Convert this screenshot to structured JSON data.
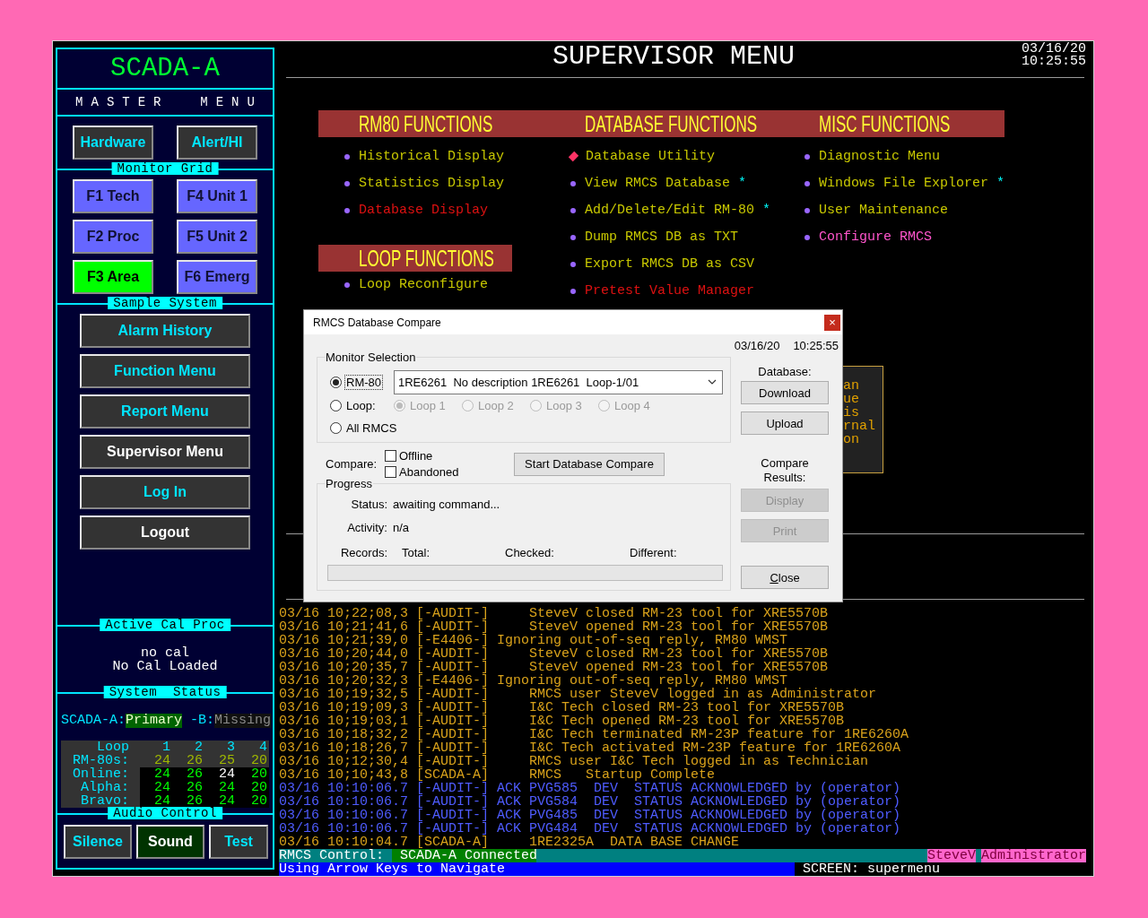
{
  "sidebar": {
    "title": "SCADA-A",
    "subtitle": "MASTER  MENU",
    "top_buttons": [
      {
        "label": "Hardware"
      },
      {
        "label": "Alert/HI"
      }
    ],
    "monitor_grid": {
      "label": "Monitor Grid",
      "buttons": [
        {
          "label": "F1 Tech",
          "selected": false
        },
        {
          "label": "F4 Unit 1",
          "selected": false
        },
        {
          "label": "F2 Proc",
          "selected": false
        },
        {
          "label": "F5 Unit 2",
          "selected": false
        },
        {
          "label": "F3 Area",
          "selected": true
        },
        {
          "label": "F6 Emerg",
          "selected": false
        }
      ]
    },
    "sample_system": {
      "label": "Sample System",
      "buttons": [
        {
          "label": "Alarm History",
          "kind": "nav"
        },
        {
          "label": "Function Menu",
          "kind": "nav"
        },
        {
          "label": "Report Menu",
          "kind": "nav"
        },
        {
          "label": "Supervisor Menu",
          "kind": "action"
        },
        {
          "label": "Log In",
          "kind": "nav"
        },
        {
          "label": "Logout",
          "kind": "action"
        }
      ]
    },
    "active_cal": {
      "label": "Active Cal Proc",
      "lines": [
        "no cal",
        "No Cal Loaded"
      ]
    },
    "system_status": {
      "label": "System  Status",
      "primary_label": "SCADA-A:",
      "primary_state": {
        "text": "Primary",
        "kind": "ok"
      },
      "backup_label": "-B:",
      "backup_state": {
        "text": "Missing",
        "kind": "missing"
      },
      "loop_table": [
        {
          "kind": "header",
          "label": "Loop",
          "values": [
            {
              "text": "1",
              "kind": "heading"
            },
            {
              "text": "2",
              "kind": "heading"
            },
            {
              "text": "3",
              "kind": "heading"
            },
            {
              "text": "4",
              "kind": "heading"
            }
          ]
        },
        {
          "kind": "count",
          "label": "RM-80s:",
          "values": [
            {
              "text": "24",
              "kind": "count"
            },
            {
              "text": "26",
              "kind": "count"
            },
            {
              "text": "25",
              "kind": "count"
            },
            {
              "text": "20",
              "kind": "count"
            }
          ]
        },
        {
          "kind": "status",
          "label": "Online:",
          "values": [
            {
              "text": "24",
              "kind": "ok"
            },
            {
              "text": "26",
              "kind": "ok"
            },
            {
              "text": "24",
              "kind": "changed"
            },
            {
              "text": "20",
              "kind": "ok"
            }
          ]
        },
        {
          "kind": "status",
          "label": "Alpha:",
          "values": [
            {
              "text": "24",
              "kind": "ok"
            },
            {
              "text": "26",
              "kind": "ok"
            },
            {
              "text": "24",
              "kind": "ok"
            },
            {
              "text": "20",
              "kind": "ok"
            }
          ]
        },
        {
          "kind": "status",
          "label": "Bravo:",
          "values": [
            {
              "text": "24",
              "kind": "ok"
            },
            {
              "text": "26",
              "kind": "ok"
            },
            {
              "text": "24",
              "kind": "ok"
            },
            {
              "text": "20",
              "kind": "ok"
            }
          ]
        }
      ]
    },
    "audio": {
      "label": "Audio Control",
      "buttons": [
        {
          "label": "Silence",
          "selected": false
        },
        {
          "label": "Sound",
          "selected": true
        },
        {
          "label": "Test",
          "selected": false
        }
      ]
    }
  },
  "header": {
    "title": "SUPERVISOR MENU",
    "date": "03/16/20",
    "time": "10:25:55"
  },
  "menu": {
    "columns": [
      {
        "heading": "RM80 FUNCTIONS",
        "items": [
          {
            "label": "Historical Display",
            "kind": "normal",
            "selected": false
          },
          {
            "label": "Statistics Display",
            "kind": "normal",
            "selected": false
          },
          {
            "label": "Database Display",
            "kind": "unavailable",
            "selected": false
          }
        ],
        "subsection": {
          "heading": "LOOP FUNCTIONS",
          "items": [
            {
              "label": "Loop Reconfigure",
              "kind": "normal",
              "selected": false
            }
          ]
        }
      },
      {
        "heading": "DATABASE FUNCTIONS",
        "items": [
          {
            "label": "Database Utility",
            "kind": "normal",
            "selected": true
          },
          {
            "label": "View RMCS Database",
            "kind": "normal",
            "selected": false,
            "note": "*"
          },
          {
            "label": "Add/Delete/Edit RM-80",
            "kind": "normal",
            "selected": false,
            "note": "*"
          },
          {
            "label": "Dump RMCS DB as TXT",
            "kind": "normal",
            "selected": false
          },
          {
            "label": "Export RMCS DB as CSV",
            "kind": "normal",
            "selected": false
          },
          {
            "label": "Pretest Value Manager",
            "kind": "unavailable",
            "selected": false
          }
        ]
      },
      {
        "heading": "MISC FUNCTIONS",
        "items": [
          {
            "label": "Diagnostic Menu",
            "kind": "normal",
            "selected": false
          },
          {
            "label": "Windows File Explorer",
            "kind": "normal",
            "selected": false,
            "note": "*"
          },
          {
            "label": "User Maintenance",
            "kind": "normal",
            "selected": false
          },
          {
            "label": "Configure RMCS",
            "kind": "highlight",
            "selected": false
          }
        ]
      }
    ]
  },
  "hidden_panel": {
    "lines": [
      "an",
      "ue",
      "is",
      "rnal",
      "on"
    ]
  },
  "dialog": {
    "title": "RMCS Database Compare",
    "close": "×",
    "date": "03/16/20",
    "time": "10:25:55",
    "monitor_selection": {
      "label": "Monitor Selection",
      "options": [
        {
          "label": "RM-80",
          "selected": true,
          "focused": true
        },
        {
          "label": "Loop:",
          "selected": false,
          "focused": false
        },
        {
          "label": "All RMCS",
          "selected": false,
          "focused": false
        }
      ],
      "device": "1RE6261  No description 1RE6261  Loop-1/01",
      "loops": [
        {
          "label": "Loop 1",
          "selected": true,
          "disabled": true
        },
        {
          "label": "Loop 2",
          "selected": false,
          "disabled": true
        },
        {
          "label": "Loop 3",
          "selected": false,
          "disabled": true
        },
        {
          "label": "Loop 4",
          "selected": false,
          "disabled": true
        }
      ]
    },
    "compare": {
      "label": "Compare:",
      "options": [
        {
          "label": "Offline",
          "checked": false
        },
        {
          "label": "Abandoned",
          "checked": false
        }
      ],
      "start_button": "Start Database Compare"
    },
    "progress": {
      "label": "Progress",
      "status_label": "Status:",
      "status": "awaiting command...",
      "activity_label": "Activity:",
      "activity": "n/a",
      "records_label": "Records:",
      "total_label": "Total:",
      "checked_label": "Checked:",
      "different_label": "Different:",
      "level": 0
    },
    "database_label": "Database:",
    "database_buttons": [
      {
        "label": "Download",
        "disabled": false
      },
      {
        "label": "Upload",
        "disabled": false
      }
    ],
    "results_label": "Compare Results:",
    "result_buttons": [
      {
        "label": "Display",
        "disabled": true
      },
      {
        "label": "Print",
        "disabled": true
      }
    ],
    "close_button": "Close"
  },
  "log": [
    {
      "kind": "event",
      "text": "03/16 10;22;08,3 [-AUDIT-]     SteveV closed RM-23 tool for XRE5570B"
    },
    {
      "kind": "event",
      "text": "03/16 10;21;41,6 [-AUDIT-]     SteveV opened RM-23 tool for XRE5570B"
    },
    {
      "kind": "event",
      "text": "03/16 10;21;39,0 [-E4406-] Ignoring out-of-seq reply, RM80 WMST"
    },
    {
      "kind": "event",
      "text": "03/16 10;20;44,0 [-AUDIT-]     SteveV closed RM-23 tool for XRE5570B"
    },
    {
      "kind": "event",
      "text": "03/16 10;20;35,7 [-AUDIT-]     SteveV opened RM-23 tool for XRE5570B"
    },
    {
      "kind": "event",
      "text": "03/16 10;20;32,3 [-E4406-] Ignoring out-of-seq reply, RM80 WMST"
    },
    {
      "kind": "event",
      "text": "03/16 10;19;32,5 [-AUDIT-]     RMCS user SteveV logged in as Administrator"
    },
    {
      "kind": "event",
      "text": "03/16 10;19;09,3 [-AUDIT-]     I&C Tech closed RM-23 tool for XRE5570B"
    },
    {
      "kind": "event",
      "text": "03/16 10;19;03,1 [-AUDIT-]     I&C Tech opened RM-23 tool for XRE5570B"
    },
    {
      "kind": "event",
      "text": "03/16 10;18;32,2 [-AUDIT-]     I&C Tech terminated RM-23P feature for 1RE6260A"
    },
    {
      "kind": "event",
      "text": "03/16 10;18;26,7 [-AUDIT-]     I&C Tech activated RM-23P feature for 1RE6260A"
    },
    {
      "kind": "event",
      "text": "03/16 10;12;30,4 [-AUDIT-]     RMCS user I&C Tech logged in as Technician"
    },
    {
      "kind": "event",
      "text": "03/16 10;10;43,8 [SCADA-A]     RMCS   Startup Complete"
    },
    {
      "kind": "ack",
      "text": "03/16 10:10:06.7 [-AUDIT-] ACK PVG585  DEV  STATUS ACKNOWLEDGED by (operator)"
    },
    {
      "kind": "ack",
      "text": "03/16 10:10:06.7 [-AUDIT-] ACK PVG584  DEV  STATUS ACKNOWLEDGED by (operator)"
    },
    {
      "kind": "ack",
      "text": "03/16 10:10:06.7 [-AUDIT-] ACK PVG485  DEV  STATUS ACKNOWLEDGED by (operator)"
    },
    {
      "kind": "ack",
      "text": "03/16 10:10:06.7 [-AUDIT-] ACK PVG484  DEV  STATUS ACKNOWLEDGED by (operator)"
    },
    {
      "kind": "event",
      "text": "03/16 10:10:04.7 [SCADA-A]     1RE2325A  DATA BASE CHANGE"
    }
  ],
  "status_bar": {
    "control_label": "RMCS Control:",
    "control_state": "SCADA-A Connected",
    "user": "SteveV",
    "role": "Administrator",
    "hint": "Using Arrow Keys to Navigate",
    "screen": "SCREEN: supermenu"
  }
}
